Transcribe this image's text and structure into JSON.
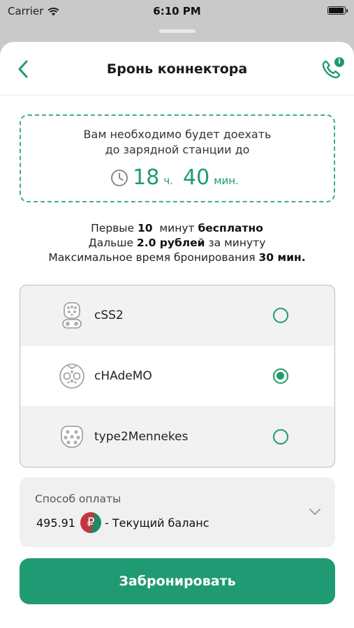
{
  "status_bar": {
    "carrier": "Carrier",
    "time": "6:10 PM"
  },
  "nav": {
    "title": "Бронь коннектора",
    "back_icon": "chevron-left-icon",
    "phone_icon": "phone-info-icon",
    "badge": "i"
  },
  "notice": {
    "line1": "Вам необходимо будет доехать",
    "line2": "до зарядной станции до",
    "hours": "18",
    "hours_unit": "ч.",
    "minutes": "40",
    "minutes_unit": "мин."
  },
  "terms": {
    "l1_a": "Первые ",
    "l1_b": "10",
    "l1_c": "  минут ",
    "l1_d": "бесплатно",
    "l2_a": "Дальше ",
    "l2_b": "2.0 рублей",
    "l2_c": " за минуту",
    "l3_a": "Максимальное время бронирования ",
    "l3_b": "30 мин."
  },
  "connectors": [
    {
      "label": "cSS2",
      "selected": false,
      "icon": "ccs2-connector-icon"
    },
    {
      "label": "cHAdeMO",
      "selected": true,
      "icon": "chademo-connector-icon"
    },
    {
      "label": "type2Mennekes",
      "selected": false,
      "icon": "type2-connector-icon"
    }
  ],
  "payment": {
    "label": "Способ оплаты",
    "amount": "495.91",
    "currency_symbol": "₽",
    "description": "- Текущий баланс"
  },
  "book_button": "Забронировать",
  "colors": {
    "accent": "#1f9a72",
    "accent_text": "#1e9c6b"
  }
}
